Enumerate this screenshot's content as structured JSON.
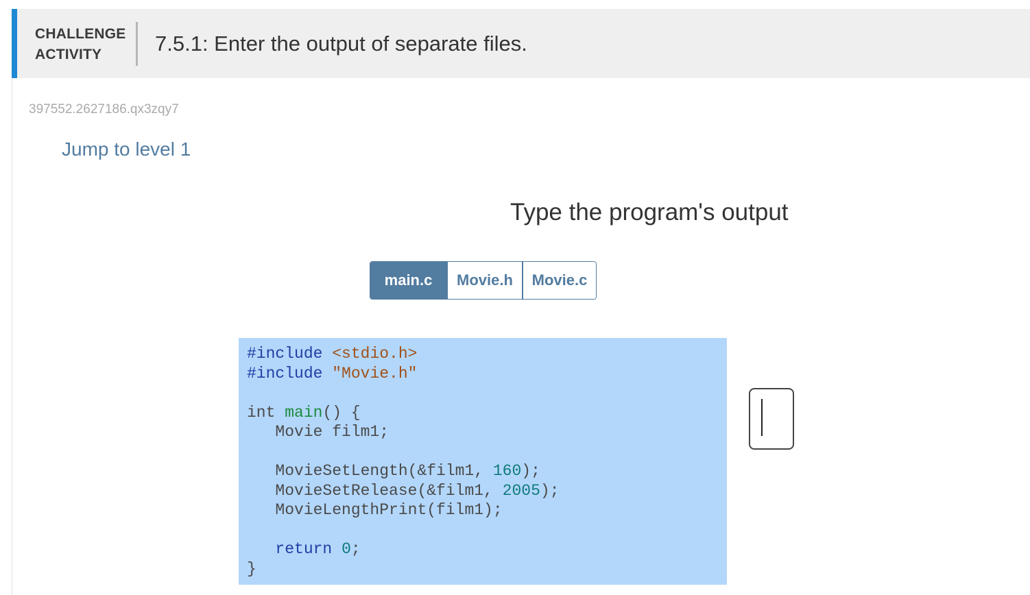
{
  "header": {
    "label_line1": "CHALLENGE",
    "label_line2": "ACTIVITY",
    "title": "7.5.1: Enter the output of separate files."
  },
  "activity_id": "397552.2627186.qx3zqy7",
  "jump_link": "Jump to level 1",
  "prompt": "Type the program's output",
  "tabs": [
    {
      "label": "main.c",
      "active": true
    },
    {
      "label": "Movie.h",
      "active": false
    },
    {
      "label": "Movie.c",
      "active": false
    }
  ],
  "code": {
    "line1_directive": "#include",
    "line1_arg": "<stdio.h>",
    "line2_directive": "#include",
    "line2_arg": "\"Movie.h\"",
    "line4_type": "int",
    "line4_func": "main",
    "line4_rest": "() {",
    "line5": "   Movie film1;",
    "line7_call": "   MovieSetLength(&film1, ",
    "line7_num": "160",
    "line7_end": ");",
    "line8_call": "   MovieSetRelease(&film1, ",
    "line8_num": "2005",
    "line8_end": ");",
    "line9": "   MovieLengthPrint(film1);",
    "line11_kw": "return",
    "line11_num": "0",
    "line11_end": ";",
    "line12": "}"
  },
  "answer": {
    "value": ""
  },
  "colors": {
    "accent": "#1e88d2",
    "link": "#527ca0",
    "code_bg": "#b3d7fb",
    "header_bg": "#efefef"
  }
}
